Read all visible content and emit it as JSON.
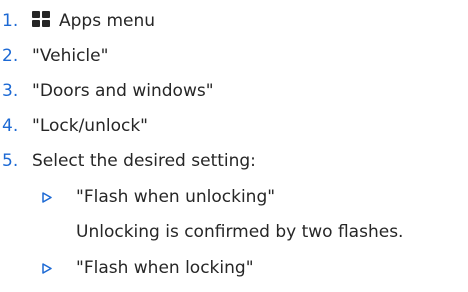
{
  "steps": [
    {
      "number": "1.",
      "text": "Apps menu",
      "icon": "apps-grid-icon"
    },
    {
      "number": "2.",
      "text": "\"Vehicle\""
    },
    {
      "number": "3.",
      "text": "\"Doors and windows\""
    },
    {
      "number": "4.",
      "text": "\"Lock/unlock\""
    },
    {
      "number": "5.",
      "text": "Select the desired setting:"
    }
  ],
  "options": [
    {
      "label": "\"Flash when unlocking\"",
      "description": "Unlocking is confirmed by two flashes."
    },
    {
      "label": "\"Flash when locking\""
    }
  ],
  "colors": {
    "number": "#1c69d4",
    "text": "#262626",
    "bullet": "#1c69d4"
  }
}
